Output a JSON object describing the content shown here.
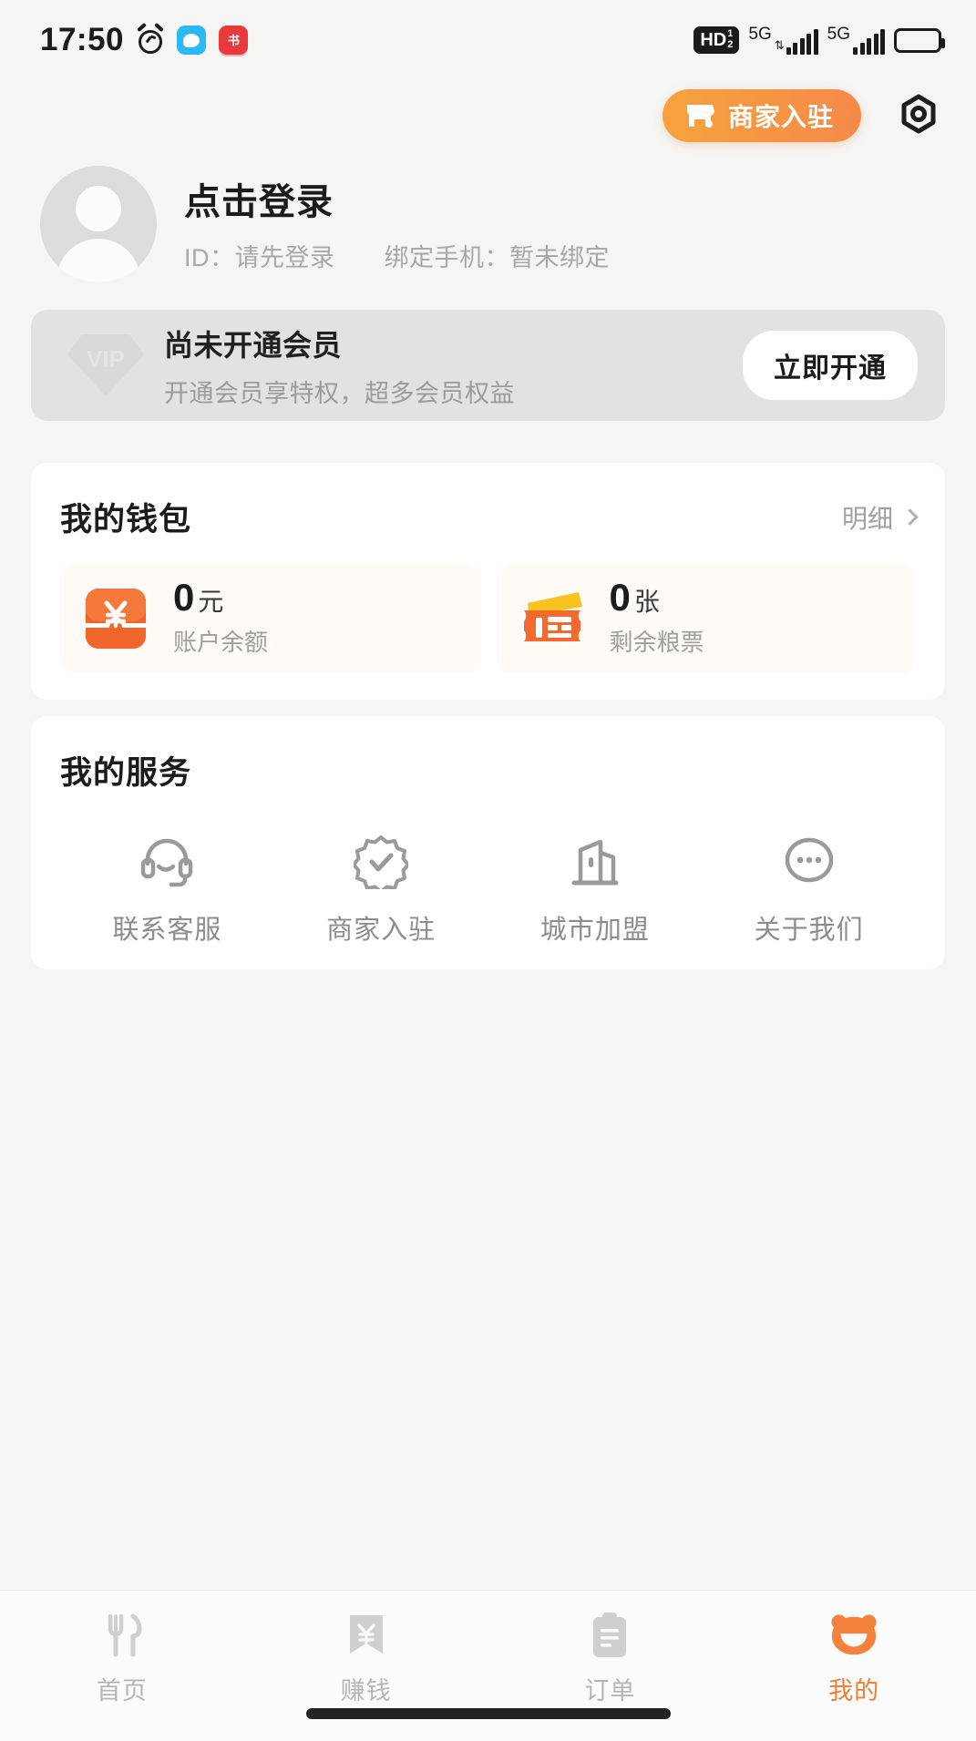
{
  "status_bar": {
    "time": "17:50",
    "icons": [
      "alarm-icon",
      "chat-app-icon",
      "red-app-icon"
    ],
    "network": {
      "hd_label": "HD",
      "hd_sub_top": "1",
      "hd_sub_bottom": "2",
      "sim1_label": "5G",
      "sim2_label": "5G"
    },
    "battery": "full"
  },
  "header": {
    "merchant_button": "商家入驻",
    "settings_icon": "gear-icon"
  },
  "profile": {
    "login_title": "点击登录",
    "id_text": "ID：请先登录",
    "phone_text": "绑定手机：暂未绑定",
    "avatar": "default-avatar"
  },
  "vip": {
    "badge": "VIP",
    "title": "尚未开通会员",
    "subtitle": "开通会员享特权，超多会员权益",
    "button": "立即开通"
  },
  "wallet": {
    "title": "我的钱包",
    "detail_link": "明细",
    "items": [
      {
        "value": "0",
        "unit": "元",
        "label": "账户余额",
        "icon": "yuan-wallet-icon"
      },
      {
        "value": "0",
        "unit": "张",
        "label": "剩余粮票",
        "icon": "food-ticket-icon"
      }
    ]
  },
  "services": {
    "title": "我的服务",
    "items": [
      {
        "label": "联系客服",
        "icon": "headset-icon"
      },
      {
        "label": "商家入驻",
        "icon": "verified-badge-icon"
      },
      {
        "label": "城市加盟",
        "icon": "building-icon"
      },
      {
        "label": "关于我们",
        "icon": "ellipsis-circle-icon"
      }
    ]
  },
  "tabbar": {
    "tabs": [
      {
        "label": "首页",
        "icon": "cutlery-icon",
        "active": false
      },
      {
        "label": "赚钱",
        "icon": "money-ticket-icon",
        "active": false
      },
      {
        "label": "订单",
        "icon": "clipboard-icon",
        "active": false
      },
      {
        "label": "我的",
        "icon": "bear-face-icon",
        "active": true
      }
    ]
  },
  "colors": {
    "accent": "#f07c35",
    "accent_gradient_start": "#f7a23c",
    "accent_gradient_end": "#f58a4b",
    "page_bg": "#f5f5f3",
    "card_bg": "#ffffff",
    "vip_bg": "#e2e2e2",
    "muted_text": "#9e9e9e"
  }
}
